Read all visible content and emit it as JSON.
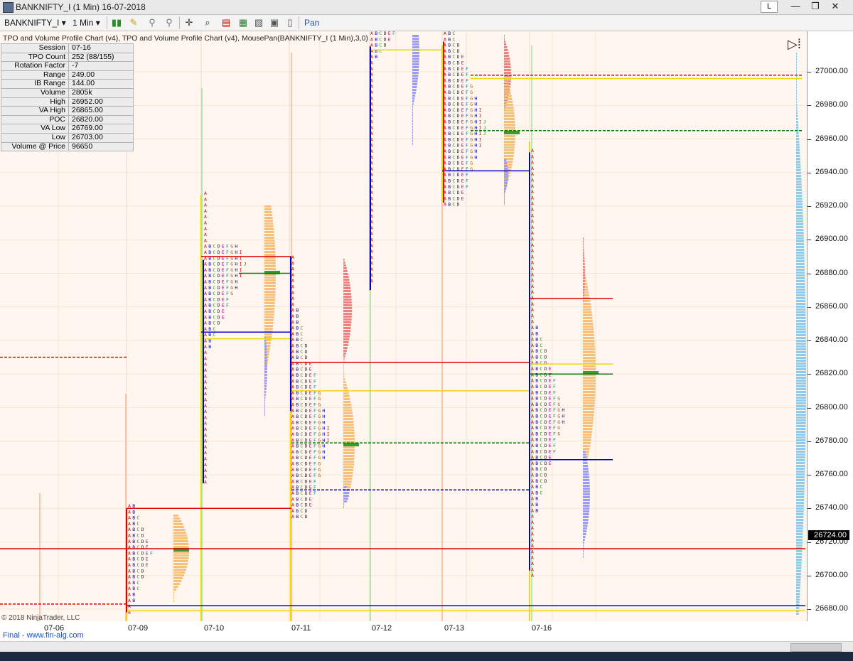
{
  "window": {
    "title": "BANKNIFTY_I (1 Min)  16-07-2018",
    "l_button": "L",
    "minimize": "—",
    "restore": "❐",
    "close": "✕"
  },
  "toolbar": {
    "instrument": "BANKNIFTY_I",
    "interval": "1 Min",
    "mode": "Pan"
  },
  "indicator_title": "TPO and Volume Profile Chart (v4), TPO and Volume Profile Chart (v4), MousePan(BANKNIFTY_I (1 Min),3,0)",
  "stats": [
    {
      "label": "Session",
      "value": "07-16"
    },
    {
      "label": "TPO Count",
      "value": "252 (88/155)"
    },
    {
      "label": "Rotation Factor",
      "value": "-7"
    },
    {
      "label": "Range",
      "value": "249.00"
    },
    {
      "label": "IB Range",
      "value": "144.00"
    },
    {
      "label": "Volume",
      "value": "2805k"
    },
    {
      "label": "High",
      "value": "26952.00"
    },
    {
      "label": "VA High",
      "value": "26865.00"
    },
    {
      "label": "POC",
      "value": "26820.00"
    },
    {
      "label": "VA Low",
      "value": "26769.00"
    },
    {
      "label": "Low",
      "value": "26703.00"
    },
    {
      "label": "Volume @ Price",
      "value": "96650"
    }
  ],
  "price_axis": [
    "27000.00",
    "26980.00",
    "26960.00",
    "26940.00",
    "26920.00",
    "26900.00",
    "26880.00",
    "26860.00",
    "26840.00",
    "26820.00",
    "26800.00",
    "26780.00",
    "26760.00",
    "26740.00",
    "26720.00",
    "26700.00",
    "26680.00"
  ],
  "current_price": "26724.00",
  "date_axis": [
    "07-06",
    "07-09",
    "07-10",
    "07-11",
    "07-12",
    "07-13",
    "07-16"
  ],
  "copyright": "© 2018 NinjaTrader, LLC",
  "footer": "Final - www.fin-alg.com",
  "colors": {
    "chart_bg": "#fff6ef",
    "vah": "#e00000",
    "val": "#0000c8",
    "poc": "#008000",
    "ib": "#f2d600",
    "volume": "#f7c07a",
    "tpo_a": "#cc0000"
  }
}
